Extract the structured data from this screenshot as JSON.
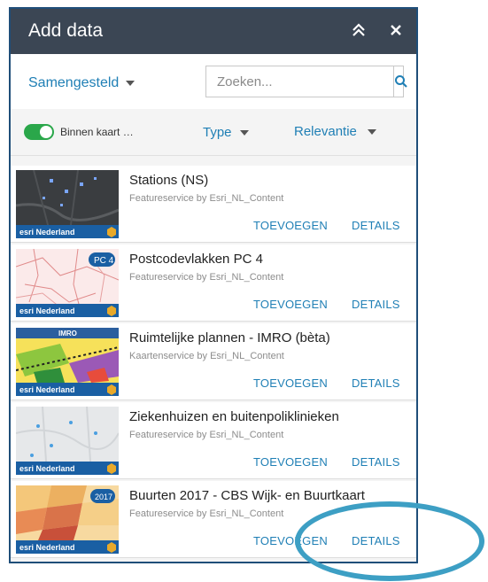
{
  "header": {
    "title": "Add data"
  },
  "search": {
    "source_label": "Samengesteld",
    "placeholder": "Zoeken..."
  },
  "filters": {
    "toggle_label": "Binnen kaart …",
    "toggle_on": true,
    "type_label": "Type",
    "relevance_label": "Relevantie"
  },
  "items": [
    {
      "title": "Stations (NS)",
      "subtitle": "Featureservice by Esri_NL_Content",
      "add_label": "TOEVOEGEN",
      "details_label": "DETAILS",
      "thumb_logo": "esri Nederland"
    },
    {
      "title": "Postcodevlakken PC 4",
      "subtitle": "Featureservice by Esri_NL_Content",
      "add_label": "TOEVOEGEN",
      "details_label": "DETAILS",
      "thumb_badge": "PC 4",
      "thumb_logo": "esri Nederland"
    },
    {
      "title": "Ruimtelijke plannen - IMRO (bèta)",
      "subtitle": "Kaartenservice by Esri_NL_Content",
      "add_label": "TOEVOEGEN",
      "details_label": "DETAILS",
      "thumb_badge": "IMRO",
      "thumb_logo": "esri Nederland"
    },
    {
      "title": "Ziekenhuizen en buitenpoliklinieken",
      "subtitle": "Featureservice by Esri_NL_Content",
      "add_label": "TOEVOEGEN",
      "details_label": "DETAILS",
      "thumb_logo": "esri Nederland"
    },
    {
      "title": "Buurten 2017 - CBS Wijk- en Buurtkaart",
      "subtitle": "Featureservice by Esri_NL_Content",
      "add_label": "TOEVOEGEN",
      "details_label": "DETAILS",
      "thumb_badge": "2017",
      "thumb_logo": "esri Nederland"
    }
  ],
  "colors": {
    "header_bg": "#3b4654",
    "accent": "#1f7fb5",
    "toggle_on": "#2aa74a",
    "highlight": "#3d9fc4"
  },
  "icons": {
    "collapse": "double-chevron-up-icon",
    "close": "close-icon",
    "search": "search-icon",
    "caret": "caret-down-icon"
  }
}
